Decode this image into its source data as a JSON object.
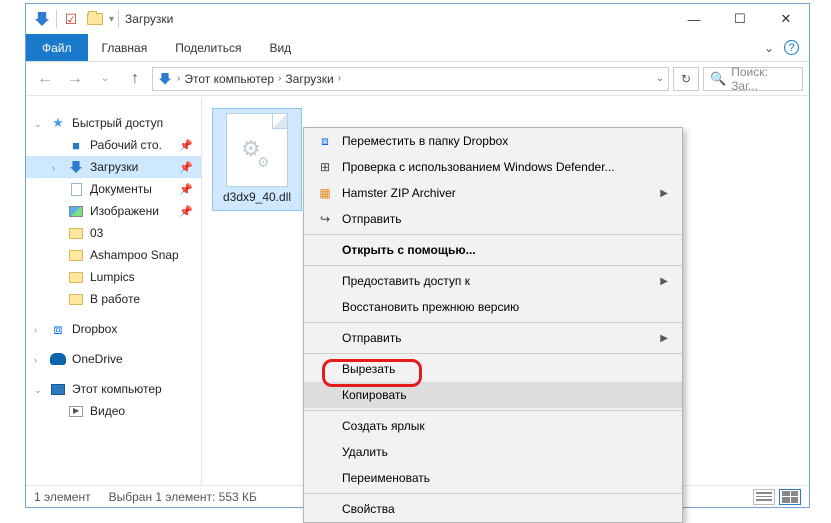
{
  "window": {
    "title": "Загрузки",
    "controls": {
      "min": "—",
      "max": "☐",
      "close": "✕"
    }
  },
  "ribbon": {
    "file": "Файл",
    "tabs": [
      "Главная",
      "Поделиться",
      "Вид"
    ]
  },
  "address": {
    "crumbs": [
      "Этот компьютер",
      "Загрузки"
    ],
    "search_placeholder": "Поиск: Заг..."
  },
  "sidebar": {
    "quick_access": "Быстрый доступ",
    "items": [
      {
        "label": "Рабочий сто.",
        "icon": "desktop",
        "pinned": true
      },
      {
        "label": "Загрузки",
        "icon": "downloads",
        "pinned": true,
        "selected": true
      },
      {
        "label": "Документы",
        "icon": "doc",
        "pinned": true
      },
      {
        "label": "Изображени",
        "icon": "img",
        "pinned": true
      },
      {
        "label": "03",
        "icon": "folder"
      },
      {
        "label": "Ashampoo Snap",
        "icon": "folder"
      },
      {
        "label": "Lumpics",
        "icon": "folder"
      },
      {
        "label": "В работе",
        "icon": "folder"
      }
    ],
    "dropbox": "Dropbox",
    "onedrive": "OneDrive",
    "this_pc": "Этот компьютер",
    "video": "Видео"
  },
  "file": {
    "name": "d3dx9_40.dll"
  },
  "context_menu": {
    "items": [
      {
        "label": "Переместить в папку Dropbox",
        "icon": "dropbox"
      },
      {
        "label": "Проверка с использованием Windows Defender...",
        "icon": "shield"
      },
      {
        "label": "Hamster ZIP Archiver",
        "icon": "hamster",
        "sub": true
      },
      {
        "label": "Отправить",
        "icon": "share"
      },
      {
        "sep": true
      },
      {
        "label": "Открыть с помощью...",
        "bold": true
      },
      {
        "sep": true
      },
      {
        "label": "Предоставить доступ к",
        "sub": true
      },
      {
        "label": "Восстановить прежнюю версию"
      },
      {
        "sep": true
      },
      {
        "label": "Отправить",
        "sub": true
      },
      {
        "sep": true
      },
      {
        "label": "Вырезать"
      },
      {
        "label": "Копировать",
        "highlight": true
      },
      {
        "sep": true
      },
      {
        "label": "Создать ярлык"
      },
      {
        "label": "Удалить"
      },
      {
        "label": "Переименовать"
      },
      {
        "sep": true
      },
      {
        "label": "Свойства"
      }
    ]
  },
  "status": {
    "count": "1 элемент",
    "selection": "Выбран 1 элемент: 553 КБ"
  }
}
